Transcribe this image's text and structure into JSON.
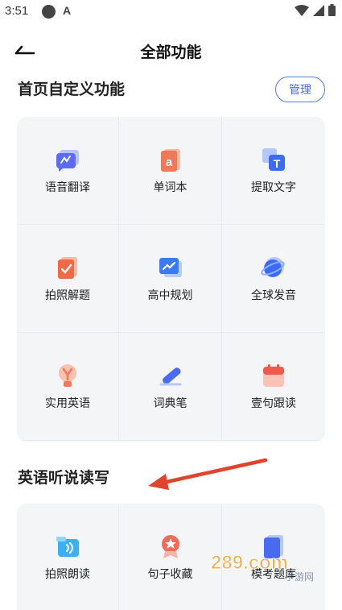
{
  "status_bar": {
    "time": "3:51",
    "a_glyph": "A"
  },
  "header": {
    "title": "全部功能"
  },
  "section_custom": {
    "title": "首页自定义功能",
    "manage_label": "管理",
    "items": [
      {
        "label": "语音翻译",
        "icon": "voice-translate-icon",
        "color": "#5b6cf0"
      },
      {
        "label": "单词本",
        "icon": "wordbook-icon",
        "color": "#f0785a"
      },
      {
        "label": "提取文字",
        "icon": "extract-text-icon",
        "color": "#3d6af0"
      },
      {
        "label": "拍照解题",
        "icon": "photo-solve-icon",
        "color": "#f06a4a"
      },
      {
        "label": "高中规划",
        "icon": "high-school-plan-icon",
        "color": "#3d7af0"
      },
      {
        "label": "全球发音",
        "icon": "globe-pronounce-icon",
        "color": "#3d6af0"
      },
      {
        "label": "实用英语",
        "icon": "bulb-english-icon",
        "color": "#f07a5a"
      },
      {
        "label": "词典笔",
        "icon": "dictionary-pen-icon",
        "color": "#4a6af0"
      },
      {
        "label": "壹句跟读",
        "icon": "calendar-read-icon",
        "color": "#f05a4a"
      }
    ]
  },
  "section_english": {
    "title": "英语听说读写",
    "items": [
      {
        "label": "拍照朗读",
        "icon": "photo-read-icon",
        "color": "#3db0f0"
      },
      {
        "label": "句子收藏",
        "icon": "sentence-collect-icon",
        "color": "#f06a5a"
      },
      {
        "label": "模考题库",
        "icon": "exam-bank-icon",
        "color": "#4a6af0"
      }
    ]
  },
  "watermark": {
    "text": "289.com",
    "subtext": "手游网"
  },
  "colors": {
    "accent": "#4a6bd0",
    "arrow": "#e0442c",
    "card_bg": "#f4f5f7"
  }
}
